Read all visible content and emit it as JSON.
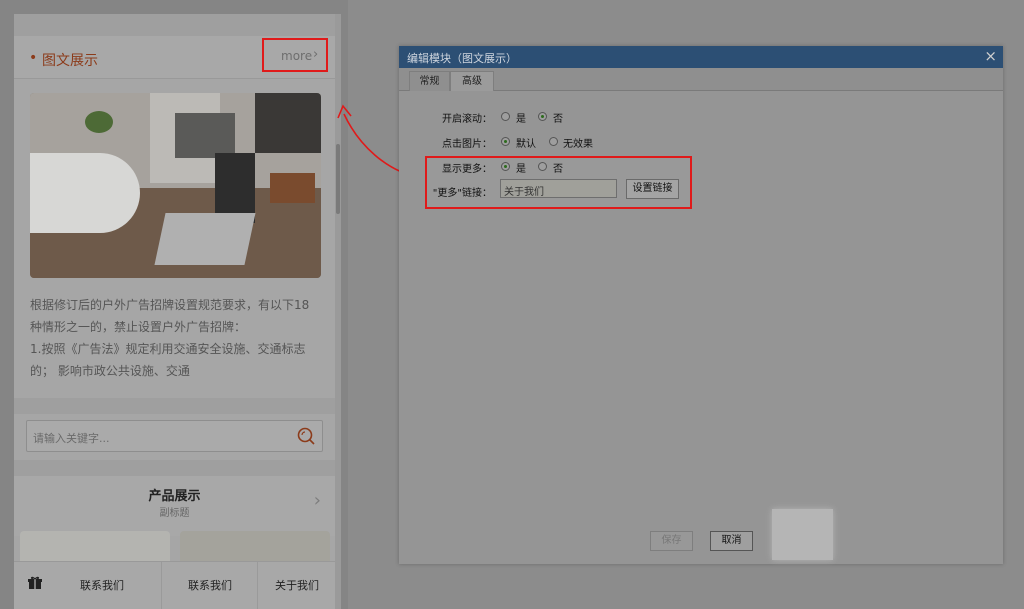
{
  "phone": {
    "section_dot": "•",
    "section_title": "图文展示",
    "more_label": "more",
    "more_arrow": "›",
    "paragraph_lines": [
      "根据修订后的户外广告招牌设置规范要求，有以下18",
      "种情形之一的，禁止设置户外广告招牌：",
      "1.按照《广告法》规定利用交通安全设施、交通标志",
      "的； 影响市政公共设施、交通"
    ],
    "search_placeholder": "请输入关键字...",
    "product_title": "产品展示",
    "product_subtitle": "副标题",
    "product_arrow": "›",
    "nav_items": [
      "联系我们",
      "联系我们",
      "关于我们"
    ]
  },
  "dialog": {
    "title": "编辑模块（图文展示）",
    "close": "×",
    "tabs": [
      "常规",
      "高级"
    ],
    "active_tab": 1,
    "rows": [
      {
        "label": "开启滚动：",
        "options": [
          "是",
          "否"
        ],
        "selected": 1
      },
      {
        "label": "点击图片：",
        "options": [
          "默认",
          "无效果"
        ],
        "selected": 0
      },
      {
        "label": "显示更多：",
        "options": [
          "是",
          "否"
        ],
        "selected": 0
      }
    ],
    "link_label": "\"更多\"链接：",
    "link_value": "关于我们",
    "set_link_button": "设置链接",
    "save_button": "保存",
    "cancel_button": "取消"
  },
  "colors": {
    "highlight": "#e01a1a",
    "title_bar": "#2c4f74",
    "section_accent": "#8c3b1a"
  }
}
